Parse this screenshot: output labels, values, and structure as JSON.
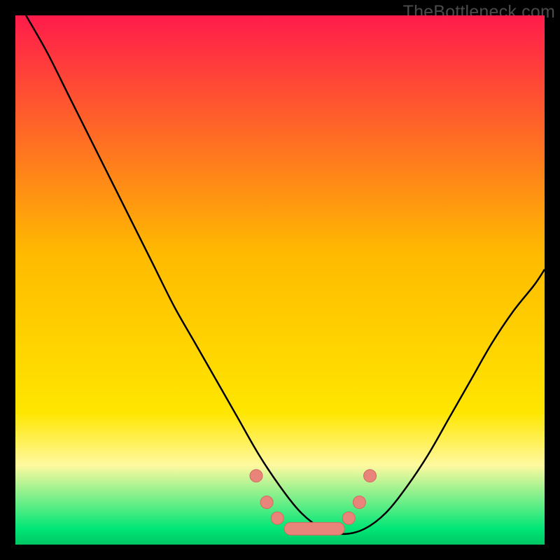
{
  "watermark": "TheBottleneck.com",
  "chart_data": {
    "type": "line",
    "title": "",
    "xlabel": "",
    "ylabel": "",
    "xlim": [
      0,
      100
    ],
    "ylim": [
      0,
      100
    ],
    "background": {
      "type": "gradient",
      "stops": [
        {
          "offset": 0,
          "color": "#ff1b4b"
        },
        {
          "offset": 45,
          "color": "#ffba00"
        },
        {
          "offset": 75,
          "color": "#ffe600"
        },
        {
          "offset": 85,
          "color": "#fff9a0"
        },
        {
          "offset": 97,
          "color": "#00e676"
        },
        {
          "offset": 100,
          "color": "#00c765"
        }
      ]
    },
    "series": [
      {
        "name": "bottleneck-curve",
        "x": [
          2,
          6,
          10,
          14,
          18,
          22,
          26,
          30,
          34,
          38,
          42,
          46,
          50,
          54,
          58,
          62,
          66,
          70,
          74,
          78,
          82,
          86,
          90,
          94,
          98,
          100
        ],
        "y": [
          100,
          93,
          85,
          77,
          69,
          61,
          53,
          45,
          38,
          31,
          24,
          17,
          11,
          6,
          3,
          2,
          3,
          6,
          11,
          17,
          24,
          31,
          38,
          44,
          49,
          52
        ]
      }
    ],
    "markers": [
      {
        "x": 45.5,
        "y": 13,
        "type": "dot"
      },
      {
        "x": 47.5,
        "y": 8,
        "type": "dot"
      },
      {
        "x": 49.5,
        "y": 5,
        "type": "dot"
      },
      {
        "x": 52,
        "y": 3,
        "type": "pill-start"
      },
      {
        "x": 61,
        "y": 3,
        "type": "pill-end"
      },
      {
        "x": 63,
        "y": 5,
        "type": "dot"
      },
      {
        "x": 65,
        "y": 8,
        "type": "dot"
      },
      {
        "x": 67,
        "y": 13,
        "type": "dot"
      }
    ]
  }
}
